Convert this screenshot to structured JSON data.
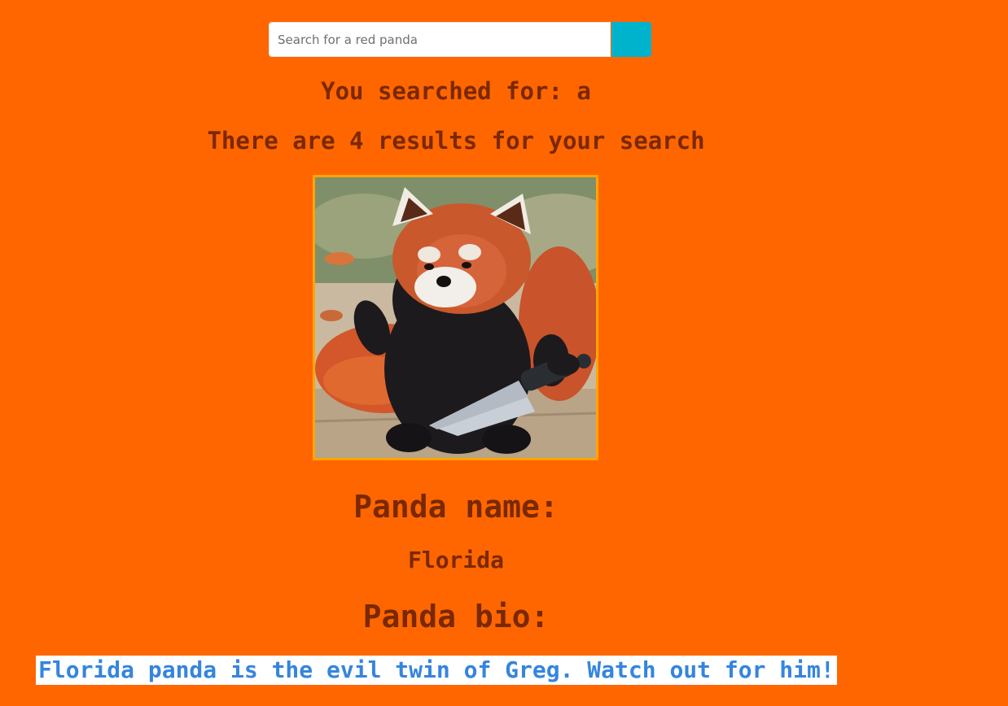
{
  "search": {
    "placeholder": "Search for a red panda",
    "value": ""
  },
  "results": {
    "searched_for": "You searched for: a",
    "count_text": "There are 4 results for your search"
  },
  "panda": {
    "name_heading": "Panda name:",
    "name": "Florida",
    "bio_heading": "Panda bio:",
    "bio": "Florida panda is the evil twin of Greg. Watch out for him!"
  },
  "colors": {
    "page_background": "#ff6600",
    "heading_text": "#7a2800",
    "search_button": "#00b3cc",
    "image_border": "#ffa500",
    "bio_text": "#3585de",
    "bio_highlight": "#ffffff"
  }
}
